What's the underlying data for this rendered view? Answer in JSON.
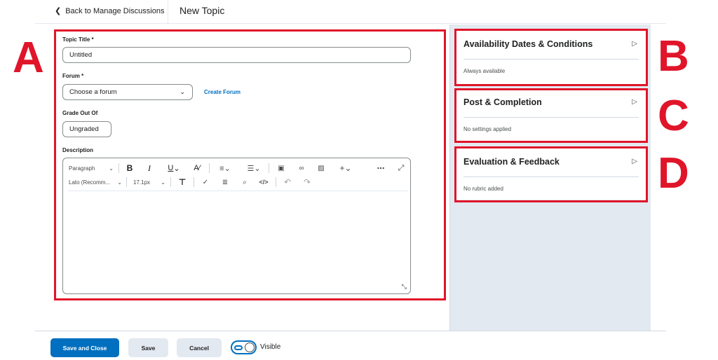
{
  "header": {
    "back_label": "Back to Manage Discussions",
    "page_title": "New Topic"
  },
  "form": {
    "topic_title_label": "Topic Title *",
    "topic_title_value": "Untitled",
    "forum_label": "Forum *",
    "forum_value": "Choose a forum",
    "create_forum_link": "Create Forum",
    "grade_label": "Grade Out Of",
    "grade_value": "Ungraded",
    "description_label": "Description"
  },
  "editor": {
    "format_select": "Paragraph",
    "font_select": "Lato (Recomm...",
    "size_select": "17.1px"
  },
  "cards": [
    {
      "title": "Availability Dates & Conditions",
      "subtitle": "Always available"
    },
    {
      "title": "Post & Completion",
      "subtitle": "No settings applied"
    },
    {
      "title": "Evaluation & Feedback",
      "subtitle": "No rubric added"
    }
  ],
  "annotations": {
    "a": "A",
    "b": "B",
    "c": "C",
    "d": "D"
  },
  "footer": {
    "save_close": "Save and Close",
    "save": "Save",
    "cancel": "Cancel",
    "visible_label": "Visible"
  },
  "colors": {
    "accent": "#006fbf",
    "annotation": "#e0152a",
    "panel": "#e3e9f1"
  }
}
